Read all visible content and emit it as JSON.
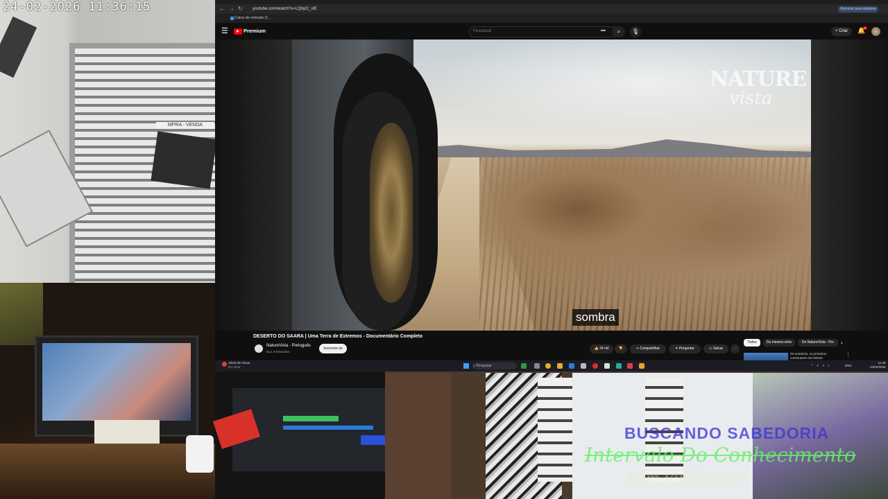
{
  "camera": {
    "timestamp": "24-02-2026 11:36:15",
    "shop_sign": "MPRA - VENDA"
  },
  "overlay": {
    "line1": "BUSCANDO SABEDORIA",
    "line2": "Intervalo Do Conhecimento",
    "line3": "Bem-Vindo 2026"
  },
  "browser": {
    "url": "youtube.com/watch?v=LQbyt2_vtE",
    "bookmark": "Caixa de entrada (1...",
    "restart_button": "Reiniciar para atualizar"
  },
  "youtube": {
    "brand": "Premium",
    "search_placeholder": "Pesquisar",
    "create_label": "Criar",
    "notifications_count": "9+",
    "video": {
      "watermark_line1": "NATURE",
      "watermark_line2": "vista",
      "subtitle": "sombra",
      "title": "DESERTO DO SAARA | Uma Terra de Extremos - Documentário Completo"
    },
    "channel": {
      "name": "NatureVista - Português",
      "subscribers": "64,1 mil inscritos",
      "subscribe_label": "Inscrever-se"
    },
    "actions": {
      "likes": "24 mil",
      "share": "Compartilhar",
      "ask": "Perguntar",
      "save": "Salvar"
    },
    "chips": [
      "Todos",
      "Da mesma série",
      "De NatureVista - Por"
    ],
    "recommendation": {
      "title": "Os sumérios, os primeiros construtores da história"
    }
  },
  "taskbar": {
    "weather_title": "Alerta de chuva",
    "weather_sub": "Em vigor",
    "search_placeholder": "Pesquisar",
    "language": "ENG",
    "time": "11:36",
    "date": "24/02/2026"
  },
  "colors": {
    "youtube_red": "#ff0000",
    "overlay_blue": "#3a31d8",
    "overlay_green": "#6af06a",
    "overlay_yellow": "#e9f09a"
  }
}
